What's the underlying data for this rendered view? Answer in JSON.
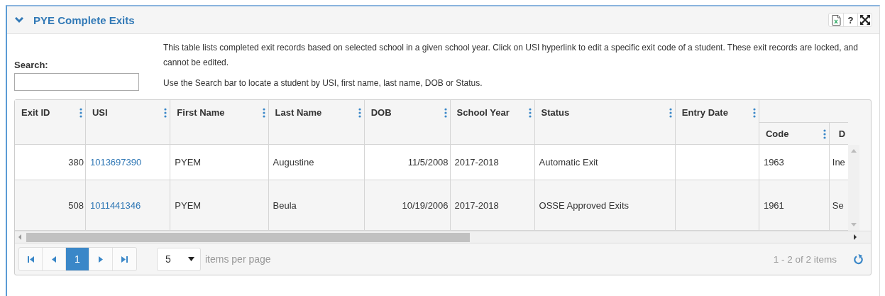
{
  "panel": {
    "title": "PYE Complete Exits",
    "expanded": true,
    "help_label": "?"
  },
  "search": {
    "label": "Search:"
  },
  "description": [
    "This table lists completed exit records based on selected school in a given school year. Click on USI hyperlink to edit a specific exit code of a student. These exit records are locked, and cannot be edited.",
    "Use the Search bar to locate a student by USI, first name, last name, DOB or Status."
  ],
  "grid": {
    "columns": [
      {
        "label": "Exit ID",
        "kind": "number",
        "menu": true
      },
      {
        "label": "USI",
        "kind": "link",
        "menu": true
      },
      {
        "label": "First Name",
        "kind": "text",
        "menu": true
      },
      {
        "label": "Last Name",
        "kind": "text",
        "menu": true
      },
      {
        "label": "DOB",
        "kind": "number",
        "menu": true
      },
      {
        "label": "School Year",
        "kind": "text",
        "menu": true
      },
      {
        "label": "Status",
        "kind": "text",
        "menu": true
      },
      {
        "label": "Entry Date",
        "kind": "text",
        "menu": true
      },
      {
        "kind": "group",
        "columns": [
          {
            "label": "Code",
            "menu": true
          },
          {
            "label": "D",
            "menu": false
          }
        ]
      }
    ],
    "rows": [
      {
        "cells": [
          "380",
          "1013697390",
          "PYEM",
          "Augustine",
          "11/5/2008",
          "2017-2018",
          "Automatic Exit",
          "",
          "1963",
          "Ine"
        ]
      },
      {
        "cells": [
          "508",
          "1011441346",
          "PYEM",
          "Beula",
          "10/19/2006",
          "2017-2018",
          "OSSE Approved Exits",
          "",
          "1961",
          "Se"
        ]
      }
    ]
  },
  "pager": {
    "pages": [
      {
        "label": "1",
        "selected": true
      }
    ],
    "page_size": "5",
    "page_size_label": "items per page",
    "summary": "1 - 2 of 2 items"
  }
}
